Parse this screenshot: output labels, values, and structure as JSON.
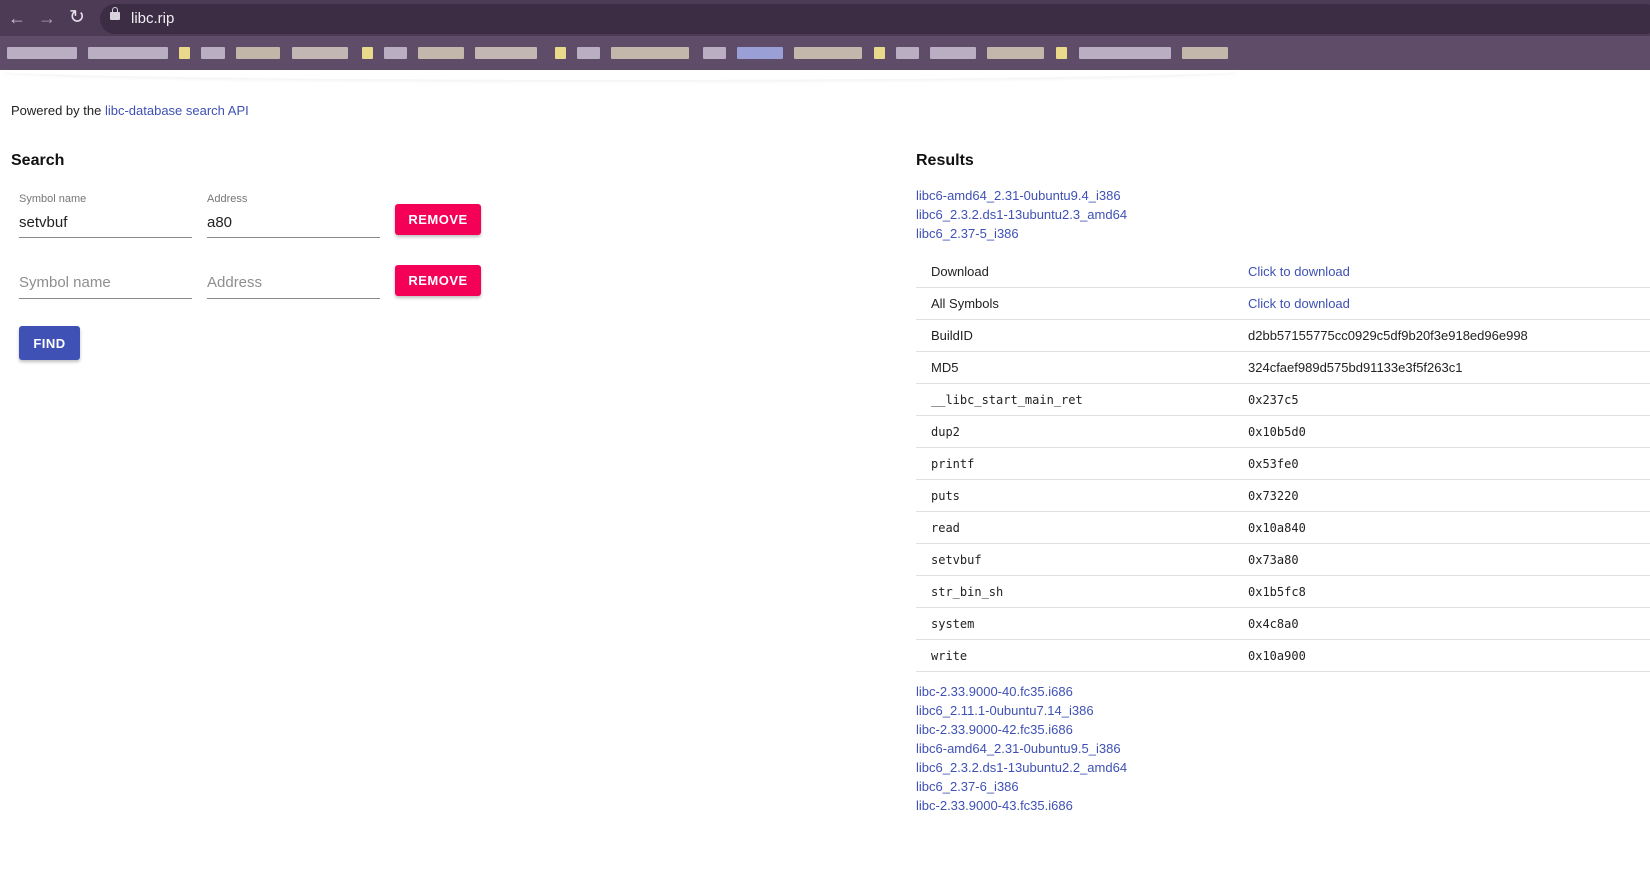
{
  "browser": {
    "url": "libc.rip",
    "nav_icons": [
      "back-arrow-icon",
      "forward-arrow-icon",
      "reload-icon",
      "lock-icon"
    ]
  },
  "page": {
    "powered_prefix": "Powered by the ",
    "powered_link": "libc-database search API"
  },
  "search": {
    "heading": "Search",
    "rows": [
      {
        "symbol_label": "Symbol name",
        "symbol_value": "setvbuf",
        "address_label": "Address",
        "address_value": "a80",
        "remove_label": "Remove"
      },
      {
        "symbol_placeholder": "Symbol name",
        "address_placeholder": "Address",
        "remove_label": "Remove"
      }
    ],
    "find_label": "Find"
  },
  "results": {
    "heading": "Results",
    "top_links": [
      "libc6-amd64_2.31-0ubuntu9.4_i386",
      "libc6_2.3.2.ds1-13ubuntu2.3_amd64",
      "libc6_2.37-5_i386"
    ],
    "details": [
      {
        "key": "Download",
        "value": "Click to download",
        "link": true,
        "mono": false
      },
      {
        "key": "All Symbols",
        "value": "Click to download",
        "link": true,
        "mono": false
      },
      {
        "key": "BuildID",
        "value": "d2bb57155775cc0929c5df9b20f3e918ed96e998",
        "link": false,
        "mono": false
      },
      {
        "key": "MD5",
        "value": "324cfaef989d575bd91133e3f5f263c1",
        "link": false,
        "mono": false
      },
      {
        "key": "__libc_start_main_ret",
        "value": "0x237c5",
        "link": false,
        "mono": true
      },
      {
        "key": "dup2",
        "value": "0x10b5d0",
        "link": false,
        "mono": true
      },
      {
        "key": "printf",
        "value": "0x53fe0",
        "link": false,
        "mono": true
      },
      {
        "key": "puts",
        "value": "0x73220",
        "link": false,
        "mono": true
      },
      {
        "key": "read",
        "value": "0x10a840",
        "link": false,
        "mono": true
      },
      {
        "key": "setvbuf",
        "value": "0x73a80",
        "link": false,
        "mono": true
      },
      {
        "key": "str_bin_sh",
        "value": "0x1b5fc8",
        "link": false,
        "mono": true
      },
      {
        "key": "system",
        "value": "0x4c8a0",
        "link": false,
        "mono": true
      },
      {
        "key": "write",
        "value": "0x10a900",
        "link": false,
        "mono": true
      }
    ],
    "bottom_links": [
      "libc-2.33.9000-40.fc35.i686",
      "libc6_2.11.1-0ubuntu7.14_i386",
      "libc-2.33.9000-42.fc35.i686",
      "libc6-amd64_2.31-0ubuntu9.5_i386",
      "libc6_2.3.2.ds1-13ubuntu2.2_amd64",
      "libc6_2.37-6_i386",
      "libc-2.33.9000-43.fc35.i686"
    ]
  }
}
